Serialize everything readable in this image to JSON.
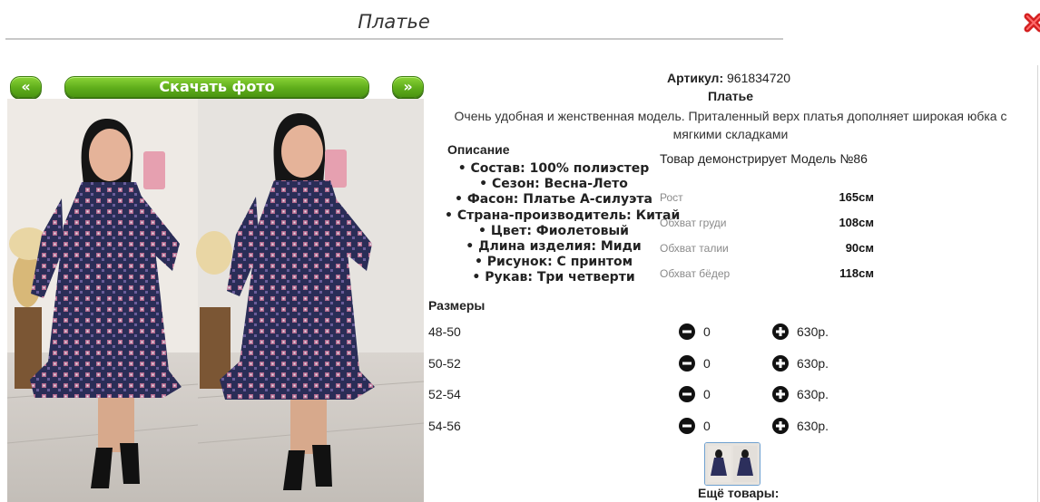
{
  "page": {
    "title": "Платье"
  },
  "gallery": {
    "prev_label": "«",
    "download_label": "Скачать фото",
    "next_label": "»"
  },
  "product": {
    "article_label": "Артикул:",
    "article_value": "961834720",
    "name": "Платье",
    "description": "Очень удобная и женственная модель. Приталенный верх платья дополняет широкая юбка с мягкими складками"
  },
  "specs": {
    "title": "Описание",
    "items": [
      "Состав: 100% полиэстер",
      "Сезон: Весна-Лето",
      "Фасон: Платье А-силуэта",
      "Страна-производитель: Китай",
      "Цвет: Фиолетовый",
      "Длина изделия: Миди",
      "Рисунок: С принтом",
      "Рукав: Три четверти"
    ]
  },
  "model": {
    "title": "Товар демонстрирует Модель №86",
    "measures": [
      {
        "label": "Рост",
        "value": "165см"
      },
      {
        "label": "Обхват груди",
        "value": "108см"
      },
      {
        "label": "Обхват талии",
        "value": "90см"
      },
      {
        "label": "Обхват бёдер",
        "value": "118см"
      }
    ]
  },
  "sizes": {
    "title": "Размеры",
    "rows": [
      {
        "size": "48-50",
        "qty": "0",
        "price": "630р."
      },
      {
        "size": "50-52",
        "qty": "0",
        "price": "630р."
      },
      {
        "size": "52-54",
        "qty": "0",
        "price": "630р."
      },
      {
        "size": "54-56",
        "qty": "0",
        "price": "630р."
      }
    ]
  },
  "footer": {
    "more_label": "Ещё товары:"
  },
  "icons": {
    "close": "close-icon",
    "minus": "minus-circle-icon",
    "plus": "plus-circle-icon"
  },
  "colors": {
    "accent_green": "#5fad1b",
    "close_red": "#d42020",
    "thumb_border": "#6ea0cf"
  }
}
